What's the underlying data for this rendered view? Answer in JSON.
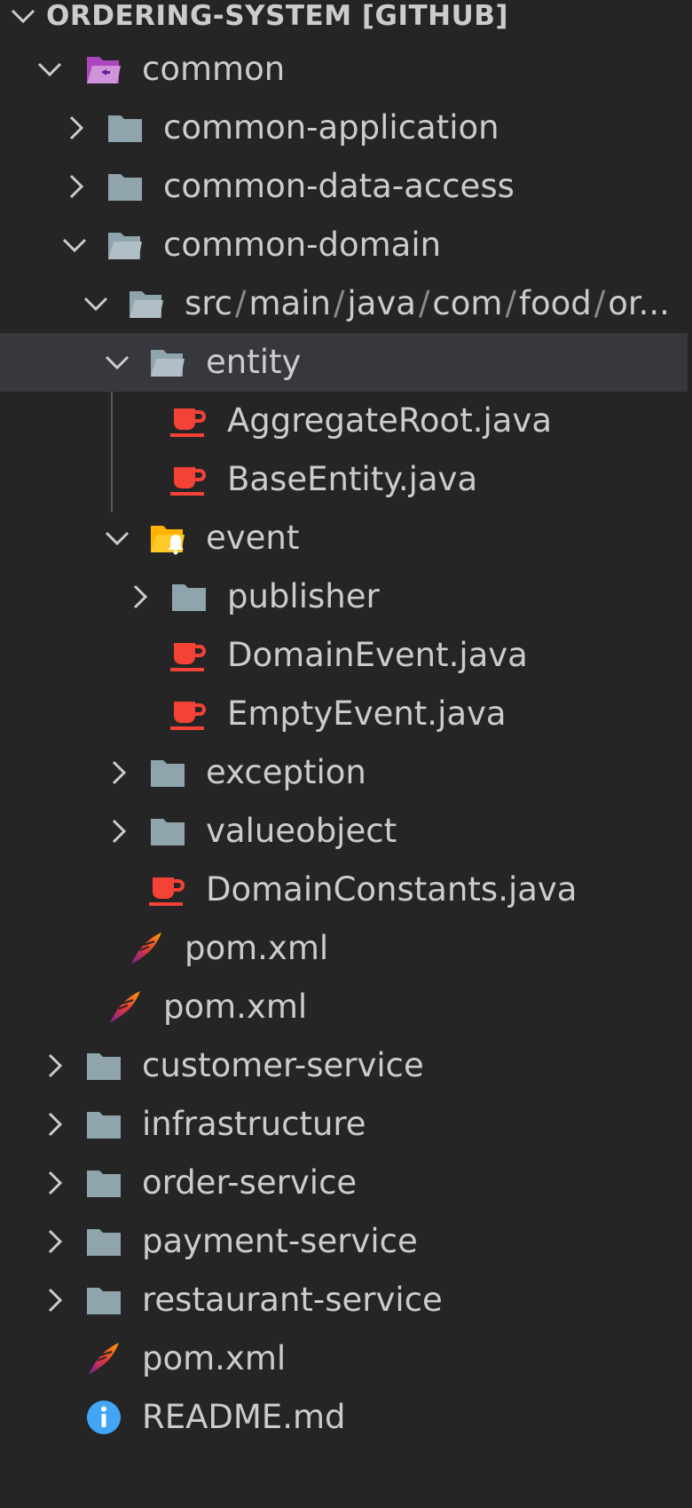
{
  "section": {
    "title": "ORDERING-SYSTEM [GITHUB]"
  },
  "tree": {
    "common": "common",
    "common_application": "common-application",
    "common_data_access": "common-data-access",
    "common_domain": "common-domain",
    "src_path": [
      "src",
      "main",
      "java",
      "com",
      "food",
      "or..."
    ],
    "path_separator": "/",
    "entity": "entity",
    "aggregate_root": "AggregateRoot.java",
    "base_entity": "BaseEntity.java",
    "event": "event",
    "publisher": "publisher",
    "domain_event": "DomainEvent.java",
    "empty_event": "EmptyEvent.java",
    "exception": "exception",
    "valueobject": "valueobject",
    "domain_constants": "DomainConstants.java",
    "common_domain_pom": "pom.xml",
    "common_pom": "pom.xml",
    "customer_service": "customer-service",
    "infrastructure": "infrastructure",
    "order_service": "order-service",
    "payment_service": "payment-service",
    "restaurant_service": "restaurant-service",
    "root_pom": "pom.xml",
    "readme": "README.md"
  },
  "colors": {
    "background": "#252526",
    "selected_row": "#37373d",
    "text": "#cccccc",
    "folder_icon": "#90a4ae",
    "java_icon": "#f44336",
    "special_folder_purple": "#ab47bc",
    "event_folder_yellow": "#ffca28",
    "info_blue": "#42a5f5"
  },
  "icons": {
    "folder": "folder-icon",
    "folder_open": "folder-open-icon",
    "java": "java-file-icon",
    "maven": "maven-feather-icon",
    "info": "info-icon",
    "chevron_right": "chevron-right-icon",
    "chevron_down": "chevron-down-icon"
  }
}
